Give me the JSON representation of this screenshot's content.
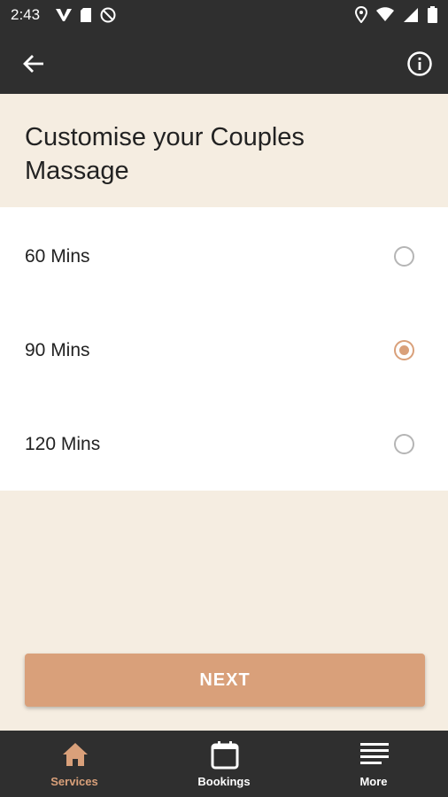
{
  "status_bar": {
    "time": "2:43",
    "left_icons": [
      "v-icon",
      "sd-card-icon",
      "no-sync-icon"
    ],
    "right_icons": [
      "location-icon",
      "wifi-icon",
      "signal-icon",
      "battery-icon"
    ]
  },
  "app_bar": {
    "back_icon": "arrow-back-icon",
    "info_icon": "info-icon"
  },
  "page": {
    "title": "Customise your Couples Massage"
  },
  "options": [
    {
      "label": "60 Mins",
      "selected": false
    },
    {
      "label": "90 Mins",
      "selected": true
    },
    {
      "label": "120 Mins",
      "selected": false
    }
  ],
  "next_button": {
    "label": "NEXT"
  },
  "bottom_nav": {
    "items": [
      {
        "label": "Services",
        "icon": "home-icon",
        "active": true
      },
      {
        "label": "Bookings",
        "icon": "calendar-icon",
        "active": false
      },
      {
        "label": "More",
        "icon": "menu-icon",
        "active": false
      }
    ]
  },
  "colors": {
    "accent": "#d9a07a",
    "dark_bar": "#2f2f2f",
    "beige_background": "#f5ede1"
  }
}
